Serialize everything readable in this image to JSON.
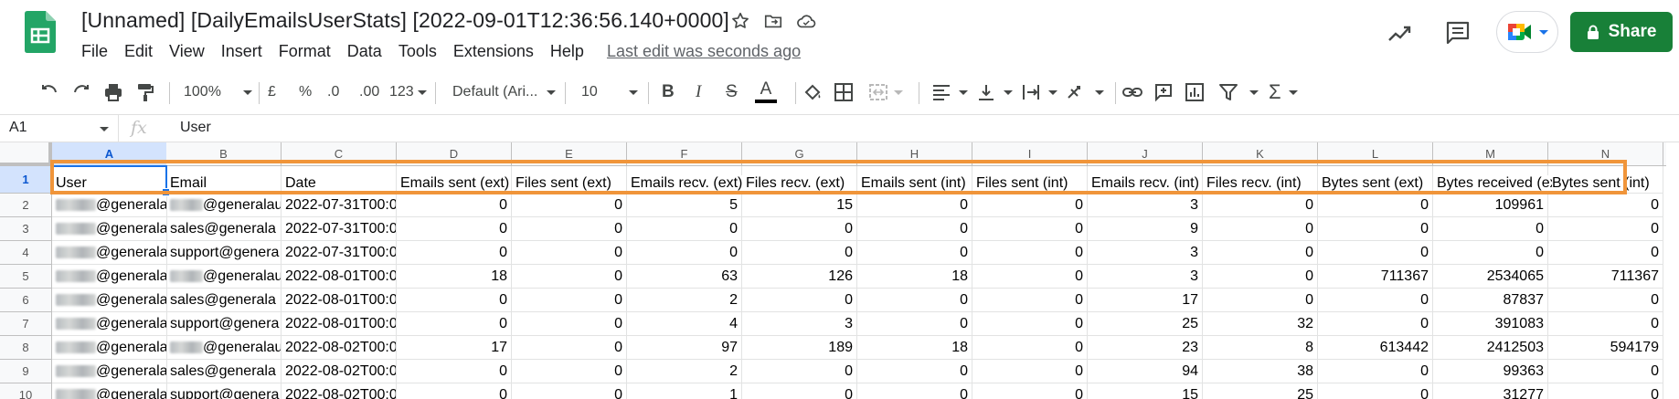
{
  "title_bar": {
    "doc_title": "[Unnamed] [DailyEmailsUserStats] [2022-09-01T12:36:56.140+0000]",
    "icons": [
      "star-icon",
      "move-to-folder-icon",
      "cloud-status-icon"
    ],
    "menus": [
      "File",
      "Edit",
      "View",
      "Insert",
      "Format",
      "Data",
      "Tools",
      "Extensions",
      "Help"
    ],
    "last_edit": "Last edit was seconds ago",
    "share_label": "Share",
    "brand_color": "#188038"
  },
  "toolbar": {
    "zoom": "100%",
    "currency": "£",
    "percent": "%",
    "decrease_decimal": ".0",
    "increase_decimal": ".00",
    "more_formats": "123",
    "font": "Default (Ari...",
    "font_size": "10",
    "bold": "B",
    "italic": "I",
    "strikethrough": "S",
    "text_color_glyph": "A"
  },
  "formula_bar": {
    "cell_ref": "A1",
    "fx": "fx",
    "value": "User"
  },
  "grid": {
    "columns": [
      "A",
      "B",
      "C",
      "D",
      "E",
      "F",
      "G",
      "H",
      "I",
      "J",
      "K",
      "L",
      "M",
      "N"
    ],
    "header_row": [
      "User",
      "Email",
      "Date",
      "Emails sent (ext)",
      "Files sent (ext)",
      "Emails recv. (ext)",
      "Files recv. (ext)",
      "Emails sent (int)",
      "Files sent (int)",
      "Emails recv. (int)",
      "Files recv. (int)",
      "Bytes sent (ext)",
      "Bytes received (ext)",
      "Bytes sent (int)"
    ],
    "overflow_col_letter": "B",
    "row_numbers": [
      "1",
      "2",
      "3",
      "4",
      "5",
      "6",
      "7",
      "8",
      "9",
      "10"
    ],
    "rows": [
      {
        "user": "@generalau",
        "email_prefix": "",
        "email": "@generalau",
        "date": "2022-07-31T00:0",
        "vals": [
          "0",
          "0",
          "5",
          "15",
          "0",
          "0",
          "3",
          "0",
          "0",
          "109961",
          "0"
        ]
      },
      {
        "user": "@generalau",
        "email_prefix": "",
        "email": "sales@generala",
        "date": "2022-07-31T00:0",
        "vals": [
          "0",
          "0",
          "0",
          "0",
          "0",
          "0",
          "9",
          "0",
          "0",
          "0",
          "0"
        ]
      },
      {
        "user": "@generalau",
        "email_prefix": "",
        "email": "support@genera",
        "date": "2022-07-31T00:0",
        "vals": [
          "0",
          "0",
          "0",
          "0",
          "0",
          "0",
          "3",
          "0",
          "0",
          "0",
          "0"
        ]
      },
      {
        "user": "@generalau",
        "email_prefix": "",
        "email": "@generalau",
        "date": "2022-08-01T00:0",
        "vals": [
          "18",
          "0",
          "63",
          "126",
          "18",
          "0",
          "3",
          "0",
          "711367",
          "2534065",
          "711367"
        ]
      },
      {
        "user": "@generalau",
        "email_prefix": "",
        "email": "sales@generala",
        "date": "2022-08-01T00:0",
        "vals": [
          "0",
          "0",
          "2",
          "0",
          "0",
          "0",
          "17",
          "0",
          "0",
          "87837",
          "0"
        ]
      },
      {
        "user": "@generalau",
        "email_prefix": "",
        "email": "support@genera",
        "date": "2022-08-01T00:0",
        "vals": [
          "0",
          "0",
          "4",
          "3",
          "0",
          "0",
          "25",
          "32",
          "0",
          "391083",
          "0"
        ]
      },
      {
        "user": "@generalau",
        "email_prefix": "",
        "email": "@generalau",
        "date": "2022-08-02T00:0",
        "vals": [
          "17",
          "0",
          "97",
          "189",
          "18",
          "0",
          "23",
          "8",
          "613442",
          "2412503",
          "594179"
        ]
      },
      {
        "user": "@generalau",
        "email_prefix": "",
        "email": "sales@generala",
        "date": "2022-08-02T00:0",
        "vals": [
          "0",
          "0",
          "2",
          "0",
          "0",
          "0",
          "94",
          "38",
          "0",
          "99363",
          "0"
        ]
      },
      {
        "user": "@generalau",
        "email_prefix": "",
        "email": "support@genera",
        "date": "2022-08-02T00:0",
        "vals": [
          "0",
          "0",
          "1",
          "0",
          "0",
          "0",
          "15",
          "25",
          "0",
          "31277",
          "0"
        ]
      }
    ]
  }
}
